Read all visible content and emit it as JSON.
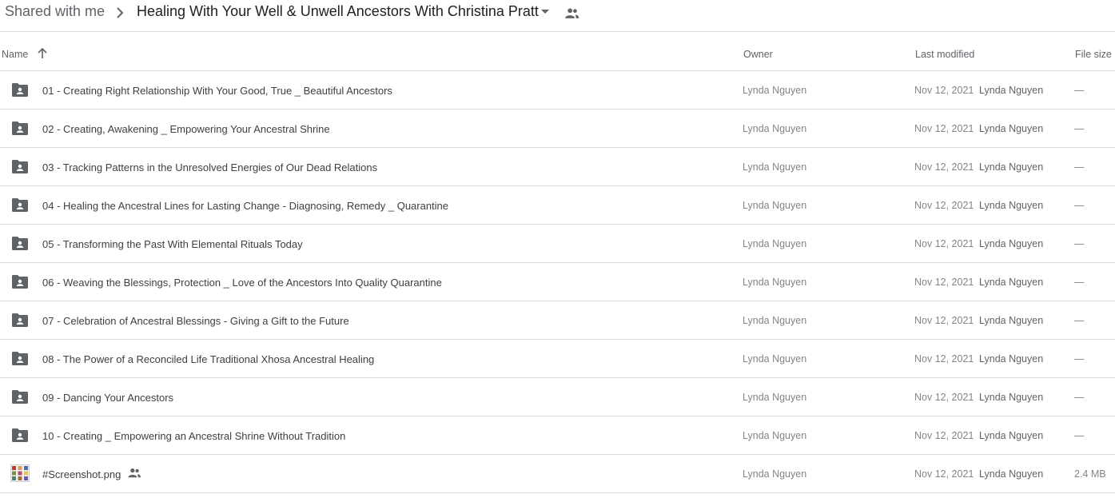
{
  "breadcrumb": {
    "root": "Shared with me",
    "current": "Healing With Your Well & Unwell Ancestors With Christina Pratt",
    "icons": [
      "chevron-right-icon",
      "caret-down-icon",
      "shared-people-icon"
    ]
  },
  "columns": {
    "name": "Name",
    "owner": "Owner",
    "last_modified": "Last modified",
    "file_size": "File size",
    "sort_icon": "arrow-up-icon"
  },
  "colors": {
    "icon_gray": "#5f6368",
    "divider": "#dadce0",
    "primary_text": "#3c4043",
    "secondary_text": "#80868b"
  },
  "files": [
    {
      "name": "01 -  Creating Right Relationship With Your Good, True _ Beautiful Ancestors",
      "owner": "Lynda Nguyen",
      "modified_date": "Nov 12, 2021",
      "modified_by": "Lynda Nguyen",
      "size": "—",
      "type": "shared-folder-icon"
    },
    {
      "name": "02 -  Creating, Awakening _ Empowering Your Ancestral Shrine",
      "owner": "Lynda Nguyen",
      "modified_date": "Nov 12, 2021",
      "modified_by": "Lynda Nguyen",
      "size": "—",
      "type": "shared-folder-icon"
    },
    {
      "name": "03 -  Tracking Patterns in the Unresolved Energies of Our Dead Relations",
      "owner": "Lynda Nguyen",
      "modified_date": "Nov 12, 2021",
      "modified_by": "Lynda Nguyen",
      "size": "—",
      "type": "shared-folder-icon"
    },
    {
      "name": "04 -  Healing the Ancestral Lines for Lasting Change - Diagnosing, Remedy _ Quarantine",
      "owner": "Lynda Nguyen",
      "modified_date": "Nov 12, 2021",
      "modified_by": "Lynda Nguyen",
      "size": "—",
      "type": "shared-folder-icon"
    },
    {
      "name": "05 -  Transforming the Past With Elemental Rituals Today",
      "owner": "Lynda Nguyen",
      "modified_date": "Nov 12, 2021",
      "modified_by": "Lynda Nguyen",
      "size": "—",
      "type": "shared-folder-icon"
    },
    {
      "name": "06 -  Weaving the Blessings, Protection _ Love of the Ancestors Into Quality Quarantine",
      "owner": "Lynda Nguyen",
      "modified_date": "Nov 12, 2021",
      "modified_by": "Lynda Nguyen",
      "size": "—",
      "type": "shared-folder-icon"
    },
    {
      "name": "07 -  Celebration of Ancestral Blessings - Giving a Gift to the Future",
      "owner": "Lynda Nguyen",
      "modified_date": "Nov 12, 2021",
      "modified_by": "Lynda Nguyen",
      "size": "—",
      "type": "shared-folder-icon"
    },
    {
      "name": "08 - The Power of a Reconciled Life Traditional Xhosa Ancestral Healing",
      "owner": "Lynda Nguyen",
      "modified_date": "Nov 12, 2021",
      "modified_by": "Lynda Nguyen",
      "size": "—",
      "type": "shared-folder-icon"
    },
    {
      "name": "09 - Dancing Your Ancestors",
      "owner": "Lynda Nguyen",
      "modified_date": "Nov 12, 2021",
      "modified_by": "Lynda Nguyen",
      "size": "—",
      "type": "shared-folder-icon"
    },
    {
      "name": "10 - Creating _ Empowering an Ancestral Shrine Without Tradition",
      "owner": "Lynda Nguyen",
      "modified_date": "Nov 12, 2021",
      "modified_by": "Lynda Nguyen",
      "size": "—",
      "type": "shared-folder-icon"
    },
    {
      "name": "#Screenshot.png",
      "owner": "Lynda Nguyen",
      "modified_date": "Nov 12, 2021",
      "modified_by": "Lynda Nguyen",
      "size": "2.4 MB",
      "type": "image-thumbnail-icon",
      "shared_badge": "shared-people-icon"
    }
  ]
}
